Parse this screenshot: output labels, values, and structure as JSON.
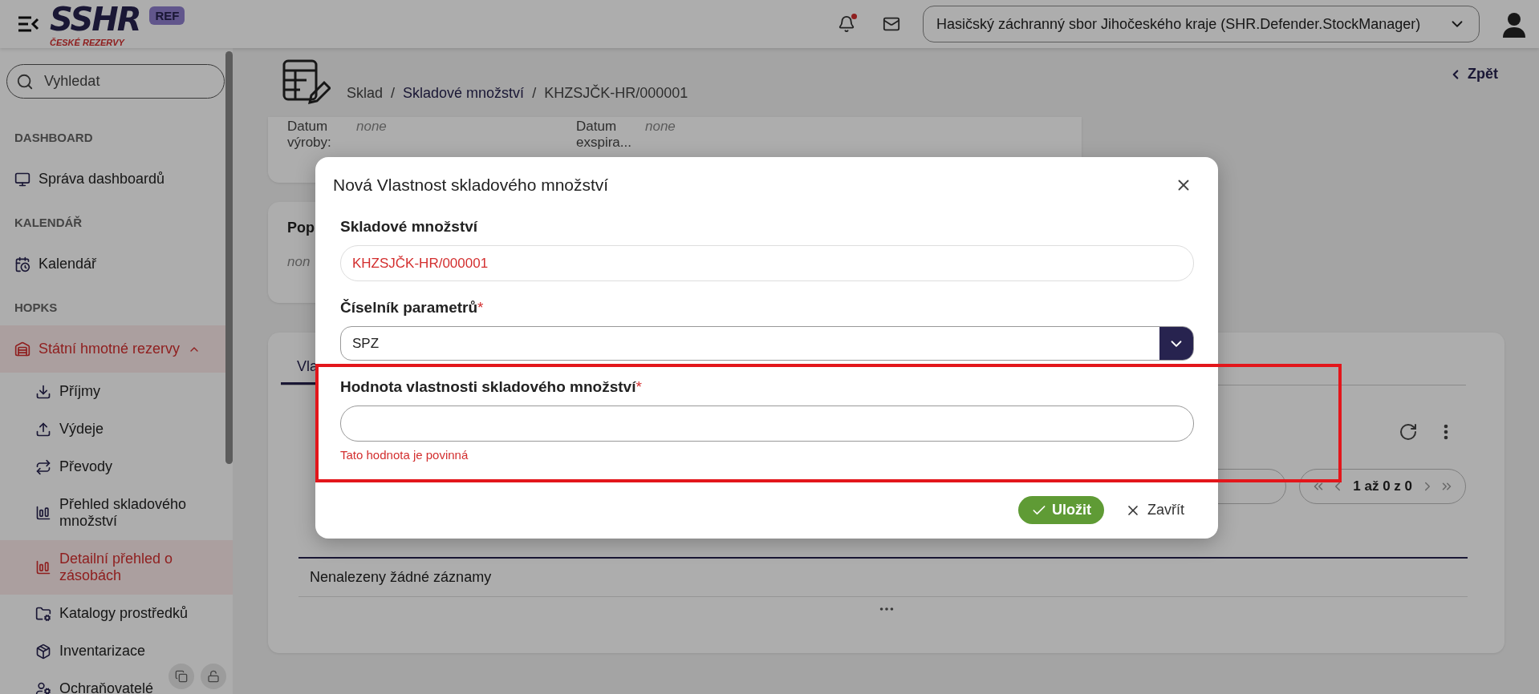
{
  "header": {
    "logo_text": "SSHR",
    "logo_subtitle": "ČESKÉ REZERVY",
    "env_badge": "REF",
    "notification_unread": true,
    "organization": "Hasičský záchranný sbor Jihočeského kraje (SHR.Defender.StockManager)"
  },
  "sidebar": {
    "search": {
      "placeholder": "Vyhledat"
    },
    "sections": [
      {
        "heading": "DASHBOARD",
        "items": [
          {
            "label": "Správa dashboardů",
            "kind": "dashboard",
            "selected": false
          }
        ]
      },
      {
        "heading": "KALENDÁŘ",
        "items": [
          {
            "label": "Kalendář",
            "kind": "calendar",
            "selected": false
          }
        ]
      },
      {
        "heading": "HOPKS",
        "items": [
          {
            "label": "Státní hmotné rezervy",
            "kind": "warehouse",
            "selected": true,
            "expanded": true,
            "children": [
              {
                "label": "Příjmy",
                "kind": "download",
                "selected": false
              },
              {
                "label": "Výdeje",
                "kind": "upload",
                "selected": false
              },
              {
                "label": "Převody",
                "kind": "transfer",
                "selected": false
              },
              {
                "label": "Přehled skladového množství",
                "kind": "chart",
                "selected": false
              },
              {
                "label": "Detailní přehled o zásobách",
                "kind": "chart",
                "selected": true
              },
              {
                "label": "Katalogy prostředků",
                "kind": "catalog",
                "selected": false
              },
              {
                "label": "Inventarizace",
                "kind": "inventory",
                "selected": false
              },
              {
                "label": "Ochraňovatelé",
                "kind": "keeper",
                "selected": false
              }
            ]
          }
        ]
      }
    ]
  },
  "page": {
    "breadcrumb": [
      {
        "label": "Sklad"
      },
      {
        "separator": "/",
        "label": "Skladové množství"
      },
      {
        "separator": "/",
        "label": "KHZSJČK-HR/000001"
      }
    ],
    "back": "Zpět",
    "detail_fields": [
      {
        "label": "Datum výroby:",
        "value": "none"
      },
      {
        "label": "Datum exspira...",
        "value": "none"
      }
    ],
    "description": {
      "title": "Pop",
      "value": "non"
    },
    "properties": {
      "tabs": [
        {
          "label": "Vla",
          "selected": true
        }
      ],
      "pager": "1 až 0 z 0",
      "empty_message": "Nenalezeny žádné záznamy"
    }
  },
  "modal": {
    "title": "Nová Vlastnost skladového množství",
    "fields": [
      {
        "label": "Skladové množství",
        "kind": "readonly",
        "value": "KHZSJČK-HR/000001",
        "highlighted": false
      },
      {
        "label": "Číselník parametrů",
        "required_mark": "*",
        "kind": "select",
        "value": "SPZ",
        "highlighted": false
      },
      {
        "label": "Hodnota vlastnosti skladového množství",
        "required_mark": "*",
        "kind": "text",
        "error": "Tato hodnota je povinná",
        "highlighted": true
      }
    ],
    "save": "Uložit",
    "close": "Zavřít"
  }
}
